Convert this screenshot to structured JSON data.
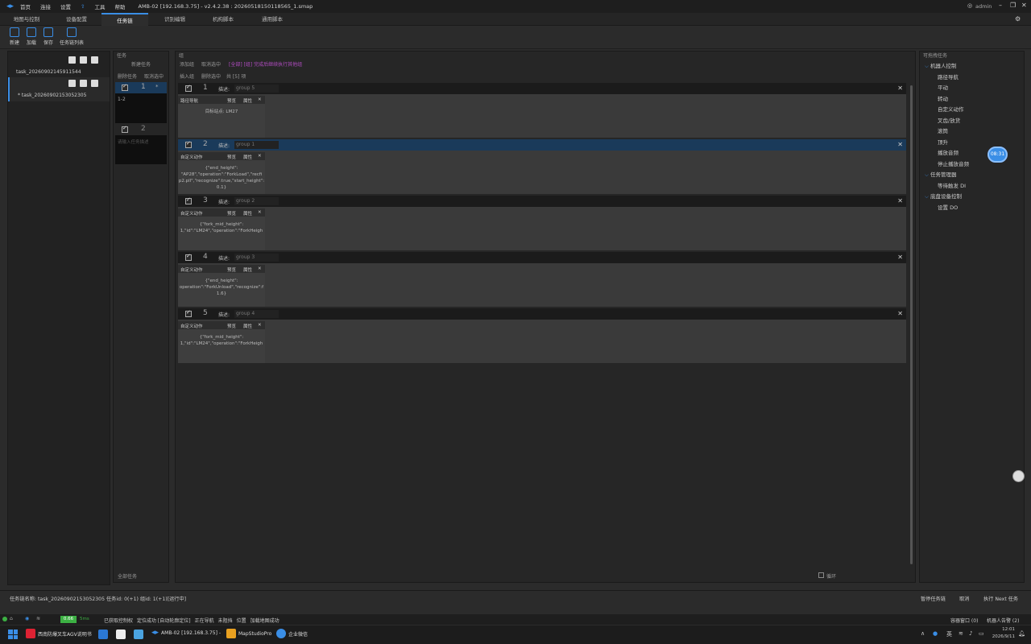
{
  "titlebar": {
    "menus": [
      "首页",
      "连接",
      "设置",
      "工具",
      "帮助"
    ],
    "window_title": "AMB-02 [192.168.3.75] - v2.4.2.38 : 20260518150118565_1.smap",
    "user": "admin"
  },
  "tabs": [
    "地图与控制",
    "设备配置",
    "任务链",
    "识别编辑",
    "机构脚本",
    "通用脚本"
  ],
  "toolbar": [
    "新建",
    "加载",
    "保存",
    "任务链列表"
  ],
  "left": {
    "tasks": [
      "task_20260902145911544",
      "* task_20260902153052305"
    ]
  },
  "taskpane": {
    "header": "任务",
    "new_task": "新建任务",
    "delete_task": "删除任务",
    "cancel_select": "取消选中",
    "row1_num": "1",
    "row1_star": "*",
    "row1_text": "1-2",
    "row2_num": "2",
    "row2_placeholder": "请输入任务描述",
    "all_tasks": "全部任务"
  },
  "mainpane": {
    "header": "组",
    "add_group": "添加组",
    "cancel_select": "取消选中",
    "links": "[全部] [组] 完成后继续执行其他组",
    "insert_group": "插入组",
    "delete_selected": "删除选中",
    "count": "共 [5] 项",
    "desc_label": "描述:",
    "loop": "循环",
    "blocks": [
      {
        "num": "1",
        "group": "group 5",
        "card": "路径导航",
        "text": "目标站点: LM27"
      },
      {
        "num": "2",
        "group": "group 1",
        "card": "自定义动作",
        "text": "{\"end_height\":\n\"AP28\",\"operation\":\"ForkLoad\",\"recfi\np2.pll\",\"recognize\":true,\"start_height\":\n0.1}"
      },
      {
        "num": "3",
        "group": "group 2",
        "card": "自定义动作",
        "text": "{\"fork_mid_height\":\n1,\"id\":\"LM24\",\"operation\":\"ForkHeigh"
      },
      {
        "num": "4",
        "group": "group 3",
        "card": "自定义动作",
        "text": "{\"end_height\":\noperation\":\"ForkUnload\",\"recognize\":f\n1.6}"
      },
      {
        "num": "5",
        "group": "group 4",
        "card": "自定义动作",
        "text": "{\"fork_mid_height\":\n1,\"id\":\"LM24\",\"operation\":\"ForkHeigh"
      }
    ],
    "card_preview": "预览",
    "card_props": "属性"
  },
  "right": {
    "header": "可拖拽任务",
    "groups": [
      {
        "label": "机器人控制",
        "items": [
          "路径导航",
          "平动",
          "转动",
          "自定义动作",
          "叉齿/放货",
          "滚筒",
          "顶升",
          "播放音频",
          "停止播放音频"
        ]
      },
      {
        "label": "任务管理器",
        "items": [
          "等待触发 DI"
        ]
      },
      {
        "label": "底盘设备控制",
        "items": [
          "设置 DO"
        ]
      }
    ],
    "timer": "08:31"
  },
  "bottom": {
    "status_text": "任务链名称: task_20260902153052305 任务id: 0(+1) 组id: 1(+1)[运行中]",
    "pause": "暂停任务链",
    "cancel": "取消",
    "next": "执行 Next 任务"
  },
  "status": {
    "signal": "5ms",
    "items": [
      "已获取控制权",
      "定位成功 [自动轮廓定位]",
      "正在导航",
      "未阻挡",
      "位置",
      "加载地图成功"
    ],
    "badge": "0.66",
    "msgs": "容器窗口 (0)",
    "alarms": "机器人告警 (2)"
  },
  "taskbar": {
    "apps": [
      "西南防爆叉车AGV说明书",
      "AMB-02 [192.168.3.75] -",
      "MapStudioPro",
      "企业微信"
    ],
    "lang": "英",
    "time": "12:01",
    "date": "2026/9/11"
  },
  "colors": {
    "accent": "#3a8ee6",
    "selected_header": "#1a3a5a",
    "badge": "#3cb043"
  }
}
